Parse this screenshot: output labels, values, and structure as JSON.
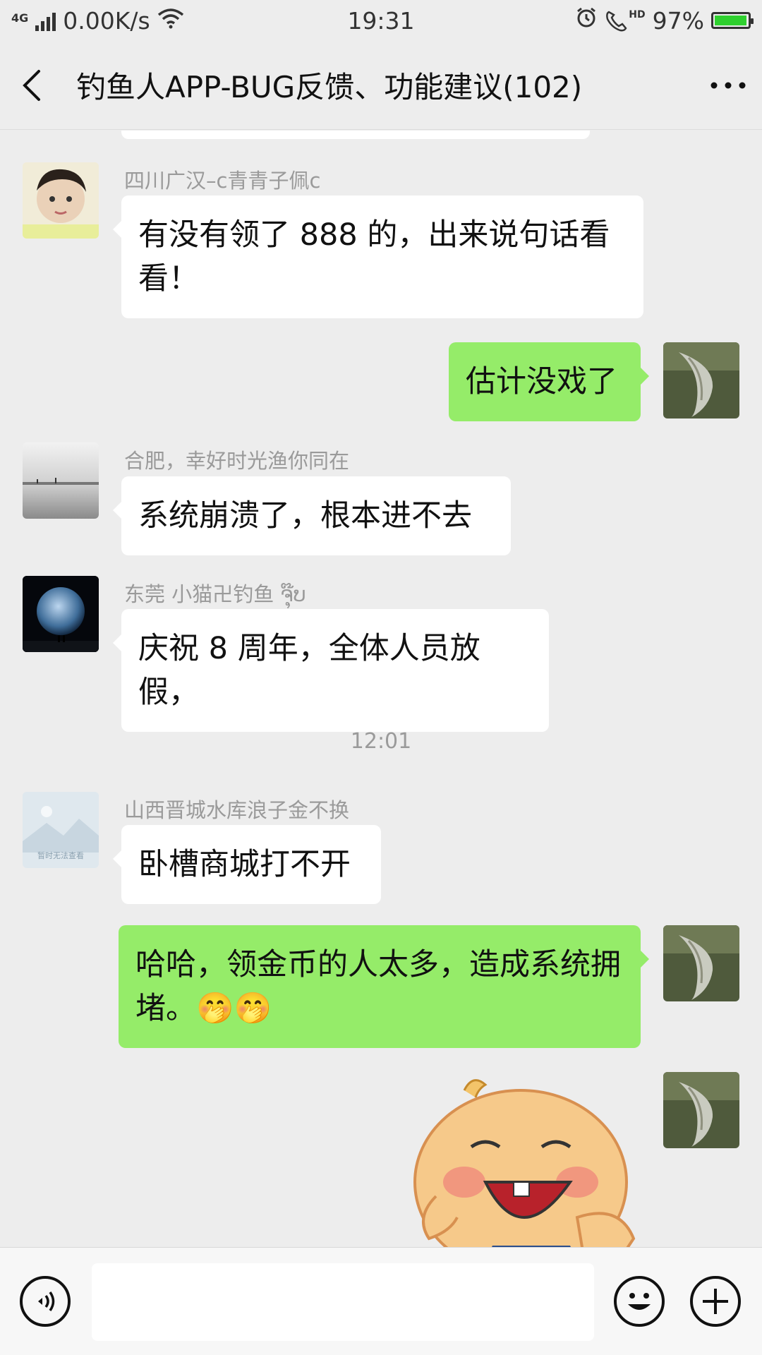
{
  "status_bar": {
    "network_type": "4G",
    "net_speed": "0.00K/s",
    "time": "19:31",
    "hd_label": "HD",
    "battery": "97%",
    "battery_level": 0.97,
    "icons": [
      "signal-icon",
      "wifi-icon",
      "alarm-icon",
      "hd-call-icon",
      "battery-icon"
    ]
  },
  "header": {
    "title": "钓鱼人APP-BUG反馈、功能建议(102)",
    "icons": [
      "back-icon",
      "more-icon"
    ]
  },
  "messages": [
    {
      "side": "left",
      "sender": "四川广汉–c青青子佩c",
      "text": "有没有领了 888 的，出来说句话看看！",
      "avatar": "child-photo"
    },
    {
      "side": "right",
      "text": "估计没戏了",
      "avatar": "fish-photo"
    },
    {
      "side": "left",
      "sender": "合肥，幸好时光渔你同在",
      "text": "系统崩溃了，根本进不去",
      "avatar": "lake-photo"
    },
    {
      "side": "left",
      "sender": "东莞   小猫卍钓鱼 ຈຸ໊ບ",
      "text": "庆祝 8 周年，全体人员放假，",
      "avatar": "moon-photo"
    },
    {
      "side": "left",
      "sender": "山西晋城水库浪子金不换",
      "text": "卧槽商城打不开",
      "avatar": "placeholder-image",
      "avatar_caption": "暂时无法查看"
    },
    {
      "side": "right",
      "text": "哈哈，领金币的人太多，造成系统拥堵。🤭🤭",
      "avatar": "fish-photo"
    },
    {
      "side": "right",
      "sticker": "laughing-baby-sticker",
      "avatar": "fish-photo"
    }
  ],
  "timestamp": "12:01",
  "input_bar": {
    "value": "",
    "icons": [
      "voice-icon",
      "emoji-icon",
      "plus-icon"
    ]
  },
  "colors": {
    "background": "#ededed",
    "bubble_self": "#95ec69",
    "bubble_other": "#ffffff",
    "battery_fill": "#2fd02f"
  }
}
